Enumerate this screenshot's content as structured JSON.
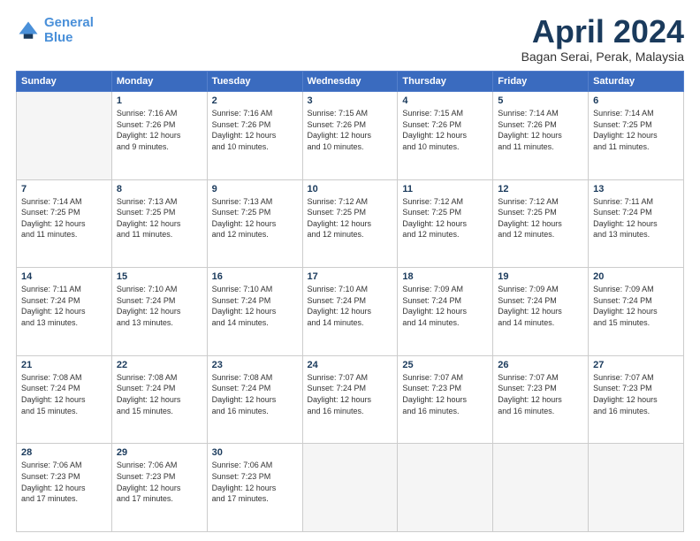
{
  "header": {
    "logo_line1": "General",
    "logo_line2": "Blue",
    "month": "April 2024",
    "location": "Bagan Serai, Perak, Malaysia"
  },
  "weekdays": [
    "Sunday",
    "Monday",
    "Tuesday",
    "Wednesday",
    "Thursday",
    "Friday",
    "Saturday"
  ],
  "weeks": [
    [
      {
        "day": "",
        "info": ""
      },
      {
        "day": "1",
        "info": "Sunrise: 7:16 AM\nSunset: 7:26 PM\nDaylight: 12 hours\nand 9 minutes."
      },
      {
        "day": "2",
        "info": "Sunrise: 7:16 AM\nSunset: 7:26 PM\nDaylight: 12 hours\nand 10 minutes."
      },
      {
        "day": "3",
        "info": "Sunrise: 7:15 AM\nSunset: 7:26 PM\nDaylight: 12 hours\nand 10 minutes."
      },
      {
        "day": "4",
        "info": "Sunrise: 7:15 AM\nSunset: 7:26 PM\nDaylight: 12 hours\nand 10 minutes."
      },
      {
        "day": "5",
        "info": "Sunrise: 7:14 AM\nSunset: 7:26 PM\nDaylight: 12 hours\nand 11 minutes."
      },
      {
        "day": "6",
        "info": "Sunrise: 7:14 AM\nSunset: 7:25 PM\nDaylight: 12 hours\nand 11 minutes."
      }
    ],
    [
      {
        "day": "7",
        "info": "Sunrise: 7:14 AM\nSunset: 7:25 PM\nDaylight: 12 hours\nand 11 minutes."
      },
      {
        "day": "8",
        "info": "Sunrise: 7:13 AM\nSunset: 7:25 PM\nDaylight: 12 hours\nand 11 minutes."
      },
      {
        "day": "9",
        "info": "Sunrise: 7:13 AM\nSunset: 7:25 PM\nDaylight: 12 hours\nand 12 minutes."
      },
      {
        "day": "10",
        "info": "Sunrise: 7:12 AM\nSunset: 7:25 PM\nDaylight: 12 hours\nand 12 minutes."
      },
      {
        "day": "11",
        "info": "Sunrise: 7:12 AM\nSunset: 7:25 PM\nDaylight: 12 hours\nand 12 minutes."
      },
      {
        "day": "12",
        "info": "Sunrise: 7:12 AM\nSunset: 7:25 PM\nDaylight: 12 hours\nand 12 minutes."
      },
      {
        "day": "13",
        "info": "Sunrise: 7:11 AM\nSunset: 7:24 PM\nDaylight: 12 hours\nand 13 minutes."
      }
    ],
    [
      {
        "day": "14",
        "info": "Sunrise: 7:11 AM\nSunset: 7:24 PM\nDaylight: 12 hours\nand 13 minutes."
      },
      {
        "day": "15",
        "info": "Sunrise: 7:10 AM\nSunset: 7:24 PM\nDaylight: 12 hours\nand 13 minutes."
      },
      {
        "day": "16",
        "info": "Sunrise: 7:10 AM\nSunset: 7:24 PM\nDaylight: 12 hours\nand 14 minutes."
      },
      {
        "day": "17",
        "info": "Sunrise: 7:10 AM\nSunset: 7:24 PM\nDaylight: 12 hours\nand 14 minutes."
      },
      {
        "day": "18",
        "info": "Sunrise: 7:09 AM\nSunset: 7:24 PM\nDaylight: 12 hours\nand 14 minutes."
      },
      {
        "day": "19",
        "info": "Sunrise: 7:09 AM\nSunset: 7:24 PM\nDaylight: 12 hours\nand 14 minutes."
      },
      {
        "day": "20",
        "info": "Sunrise: 7:09 AM\nSunset: 7:24 PM\nDaylight: 12 hours\nand 15 minutes."
      }
    ],
    [
      {
        "day": "21",
        "info": "Sunrise: 7:08 AM\nSunset: 7:24 PM\nDaylight: 12 hours\nand 15 minutes."
      },
      {
        "day": "22",
        "info": "Sunrise: 7:08 AM\nSunset: 7:24 PM\nDaylight: 12 hours\nand 15 minutes."
      },
      {
        "day": "23",
        "info": "Sunrise: 7:08 AM\nSunset: 7:24 PM\nDaylight: 12 hours\nand 16 minutes."
      },
      {
        "day": "24",
        "info": "Sunrise: 7:07 AM\nSunset: 7:24 PM\nDaylight: 12 hours\nand 16 minutes."
      },
      {
        "day": "25",
        "info": "Sunrise: 7:07 AM\nSunset: 7:23 PM\nDaylight: 12 hours\nand 16 minutes."
      },
      {
        "day": "26",
        "info": "Sunrise: 7:07 AM\nSunset: 7:23 PM\nDaylight: 12 hours\nand 16 minutes."
      },
      {
        "day": "27",
        "info": "Sunrise: 7:07 AM\nSunset: 7:23 PM\nDaylight: 12 hours\nand 16 minutes."
      }
    ],
    [
      {
        "day": "28",
        "info": "Sunrise: 7:06 AM\nSunset: 7:23 PM\nDaylight: 12 hours\nand 17 minutes."
      },
      {
        "day": "29",
        "info": "Sunrise: 7:06 AM\nSunset: 7:23 PM\nDaylight: 12 hours\nand 17 minutes."
      },
      {
        "day": "30",
        "info": "Sunrise: 7:06 AM\nSunset: 7:23 PM\nDaylight: 12 hours\nand 17 minutes."
      },
      {
        "day": "",
        "info": ""
      },
      {
        "day": "",
        "info": ""
      },
      {
        "day": "",
        "info": ""
      },
      {
        "day": "",
        "info": ""
      }
    ]
  ]
}
